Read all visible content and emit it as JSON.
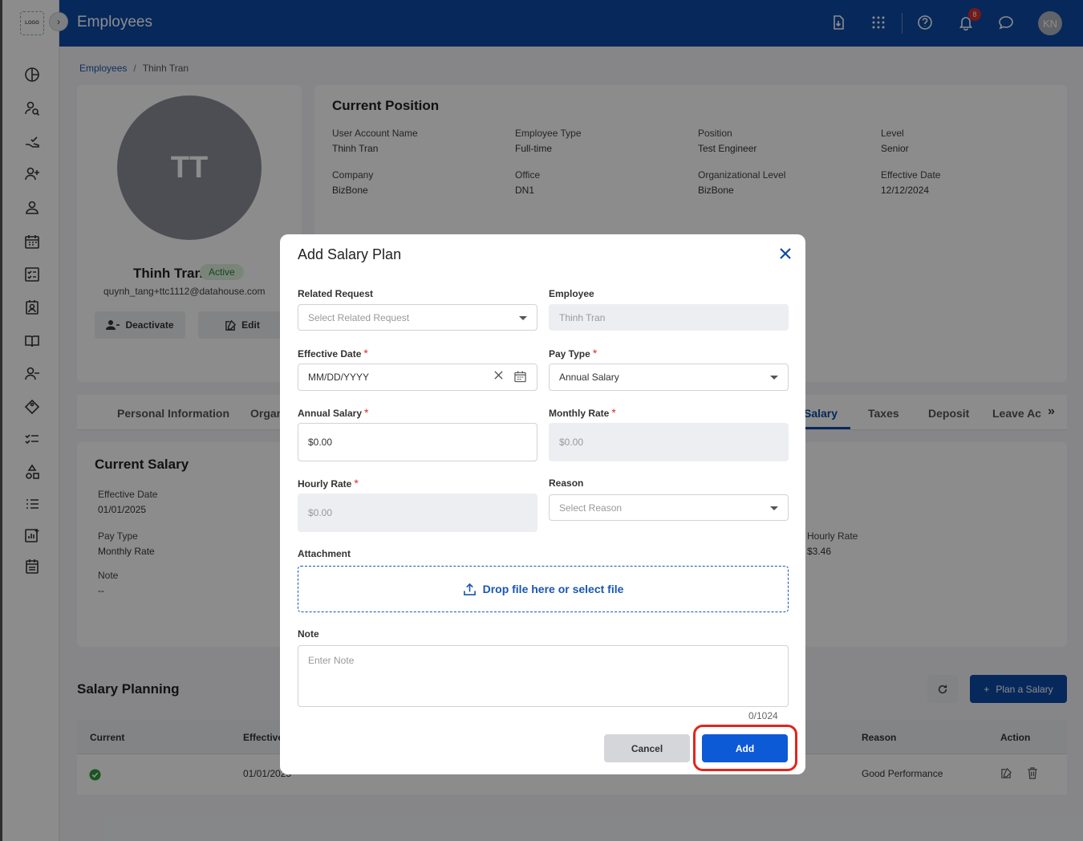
{
  "sidebar": {
    "logo_text": "LOGO"
  },
  "header": {
    "title": "Employees",
    "notification_count": "8",
    "user_initials": "KN"
  },
  "breadcrumb": {
    "parent": "Employees",
    "separator": "/",
    "current": "Thinh Tran"
  },
  "profile": {
    "initials": "TT",
    "name": "Thinh Tran",
    "status": "Active",
    "email": "quynh_tang+ttc1112@datahouse.com",
    "deactivate_label": "Deactivate",
    "edit_label": "Edit"
  },
  "position": {
    "title": "Current Position",
    "fields": [
      {
        "label": "User Account Name",
        "value": "Thinh Tran"
      },
      {
        "label": "Employee Type",
        "value": "Full-time"
      },
      {
        "label": "Position",
        "value": "Test Engineer"
      },
      {
        "label": "Level",
        "value": "Senior"
      },
      {
        "label": "Company",
        "value": "BizBone"
      },
      {
        "label": "Office",
        "value": "DN1"
      },
      {
        "label": "Organizational Level",
        "value": "BizBone"
      },
      {
        "label": "Effective Date",
        "value": "12/12/2024"
      }
    ]
  },
  "tabs": [
    "Personal Information",
    "Organ",
    "Salary",
    "Taxes",
    "Deposit",
    "Leave Ac"
  ],
  "current_salary": {
    "title": "Current Salary",
    "effective_date_label": "Effective Date",
    "effective_date": "01/01/2025",
    "pay_type_label": "Pay Type",
    "pay_type": "Monthly Rate",
    "note_label": "Note",
    "note": "--",
    "hourly_rate_label": "Hourly Rate",
    "hourly_rate": "$3.46"
  },
  "salary_planning": {
    "title": "Salary Planning",
    "plan_label": "Plan a Salary",
    "columns": [
      "Current",
      "Effective",
      "Reason",
      "Action"
    ],
    "row": {
      "effective": "01/01/2025",
      "reason": "Good Performance"
    }
  },
  "modal": {
    "title": "Add Salary Plan",
    "related_request_label": "Related Request",
    "related_request_placeholder": "Select Related Request",
    "employee_label": "Employee",
    "employee_value": "Thinh Tran",
    "effective_date_label": "Effective Date",
    "effective_date_placeholder": "MM/DD/YYYY",
    "pay_type_label": "Pay Type",
    "pay_type_value": "Annual Salary",
    "annual_salary_label": "Annual Salary",
    "annual_salary_value": "$0.00",
    "monthly_rate_label": "Monthly Rate",
    "monthly_rate_value": "$0.00",
    "hourly_rate_label": "Hourly Rate",
    "hourly_rate_value": "$0.00",
    "reason_label": "Reason",
    "reason_placeholder": "Select Reason",
    "attachment_label": "Attachment",
    "drop_text": "Drop file here or select file",
    "note_label": "Note",
    "note_placeholder": "Enter Note",
    "counter": "0/1024",
    "cancel_label": "Cancel",
    "add_label": "Add"
  },
  "colors": {
    "brand": "#0d49a6",
    "primary_button": "#0d5ad6",
    "required": "#d32f2f",
    "highlight": "#e0261b"
  }
}
